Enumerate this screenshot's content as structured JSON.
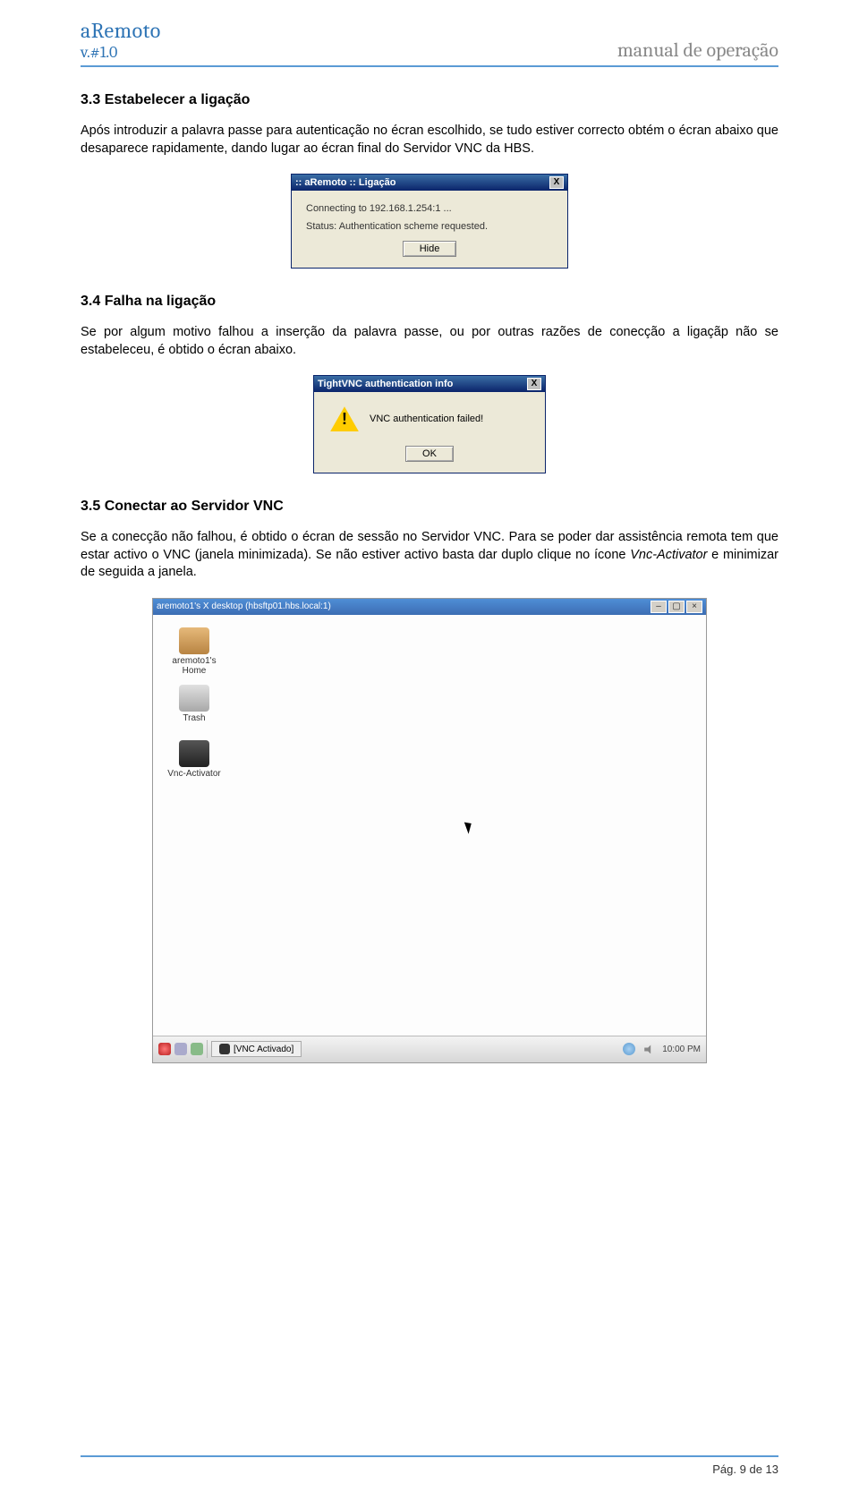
{
  "header": {
    "brand": "aRemoto",
    "version": "v.#1.0",
    "right": "manual de operação"
  },
  "s33": {
    "title": "3.3 Estabelecer a ligação",
    "para": "Após introduzir a palavra passe para autenticação no écran escolhido, se tudo estiver correcto obtém o écran abaixo que desaparece rapidamente, dando lugar ao écran final do Servidor VNC da HBS."
  },
  "dlg1": {
    "title": ":: aRemoto :: Ligação",
    "close": "X",
    "line1": "Connecting to 192.168.1.254:1 ...",
    "line2": "Status: Authentication scheme requested.",
    "button": "Hide"
  },
  "s34": {
    "title": "3.4 Falha na ligação",
    "para": "Se por algum motivo falhou a inserção da palavra passe, ou por outras razões de conecção a ligaçãp não se estabeleceu, é obtido o écran abaixo."
  },
  "dlg2": {
    "title": "TightVNC authentication info",
    "close": "X",
    "warn": "!",
    "msg": "VNC authentication failed!",
    "button": "OK"
  },
  "s35": {
    "title": "3.5 Conectar ao Servidor VNC",
    "para_plain": "Se a conecção não falhou, é obtido o écran de sessão no Servidor VNC. Para se poder dar assistência remota tem que estar activo o VNC (janela minimizada). Se não estiver activo basta dar duplo clique no ícone ",
    "para_italic": "Vnc-Activator",
    "para_tail": " e minimizar de seguida a janela."
  },
  "desk": {
    "title": "aremoto1's X desktop (hbsftp01.hbs.local:1)",
    "icon_home": "aremoto1's Home",
    "icon_trash": "Trash",
    "icon_vnc": "Vnc-Activator",
    "taskbar_label": "[VNC Activado]",
    "time": "10:00 PM"
  },
  "footer": {
    "text": "Pág. 9 de 13"
  }
}
